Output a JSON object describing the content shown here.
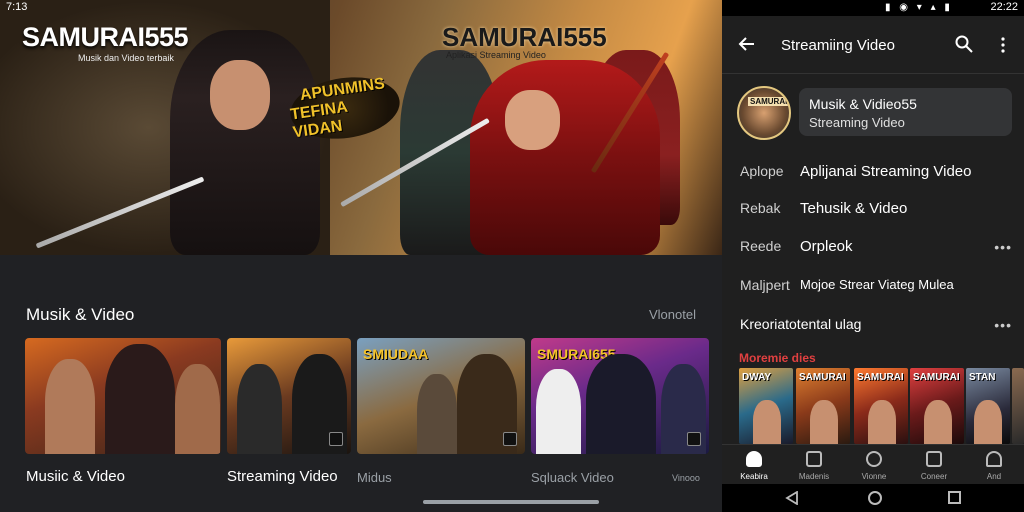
{
  "left_pane": {
    "status_time": "7:13",
    "hero": {
      "logo": "SAMURAI555",
      "logo_sub": "Musik dan Video terbaik",
      "logo2": "SAMURAI555",
      "logo2_sub": "Aplikasi Streaming Video",
      "promo_line1": "APUNMINS",
      "promo_line2": "TEFINA VIDAN"
    },
    "section": {
      "title": "Musik & Video",
      "more": "Vlonotel"
    },
    "thumbnails": [
      {
        "tag": "",
        "caption": "Musiic & Video"
      },
      {
        "tag": "",
        "caption": "Streaming Video"
      },
      {
        "tag": "SMIUDAA",
        "caption": "Midus"
      },
      {
        "tag": "SMURAI655",
        "caption": "Sqluack Video"
      }
    ],
    "extra_caption": "Vinooo"
  },
  "right_pane": {
    "status": {
      "icons": "▮ ◉ ▾ ▴ ▮",
      "time": "22:22"
    },
    "appbar": {
      "title": "Streamiing Video"
    },
    "channel": {
      "avatar_text": "SAMURAI555",
      "name": "Musik & Vidieo55",
      "subtitle": "Streaming Video"
    },
    "info_rows": [
      {
        "key": "Aplope",
        "value": "Aplijanai Streaming Video",
        "more": ""
      },
      {
        "key": "Rebak",
        "value": "Tehusik & Video",
        "more": ""
      },
      {
        "key": "Reede",
        "value": "Orpleok",
        "more": "•••"
      },
      {
        "key": "Maljpert",
        "value": "Mojoe Strear Viateg Mulea",
        "more": ""
      }
    ],
    "single_row": {
      "text": "Kreoriatotental ulag",
      "more": "•••"
    },
    "recommended": {
      "label": "Moremie dies",
      "items": [
        {
          "text": "DWAY"
        },
        {
          "text": "SAMURAI"
        },
        {
          "text": "SAMURAI"
        },
        {
          "text": "SAMURAI"
        },
        {
          "text": "STAN"
        },
        {
          "text": ""
        }
      ]
    },
    "bottom_nav": [
      {
        "label": "Keabira",
        "icon": "home-icon",
        "active": true
      },
      {
        "label": "Madenis",
        "icon": "shorts-icon",
        "active": false
      },
      {
        "label": "Vionne",
        "icon": "subscriptions-icon",
        "active": false
      },
      {
        "label": "Coneer",
        "icon": "library-icon",
        "active": false
      },
      {
        "label": "And",
        "icon": "account-icon",
        "active": false
      }
    ]
  }
}
